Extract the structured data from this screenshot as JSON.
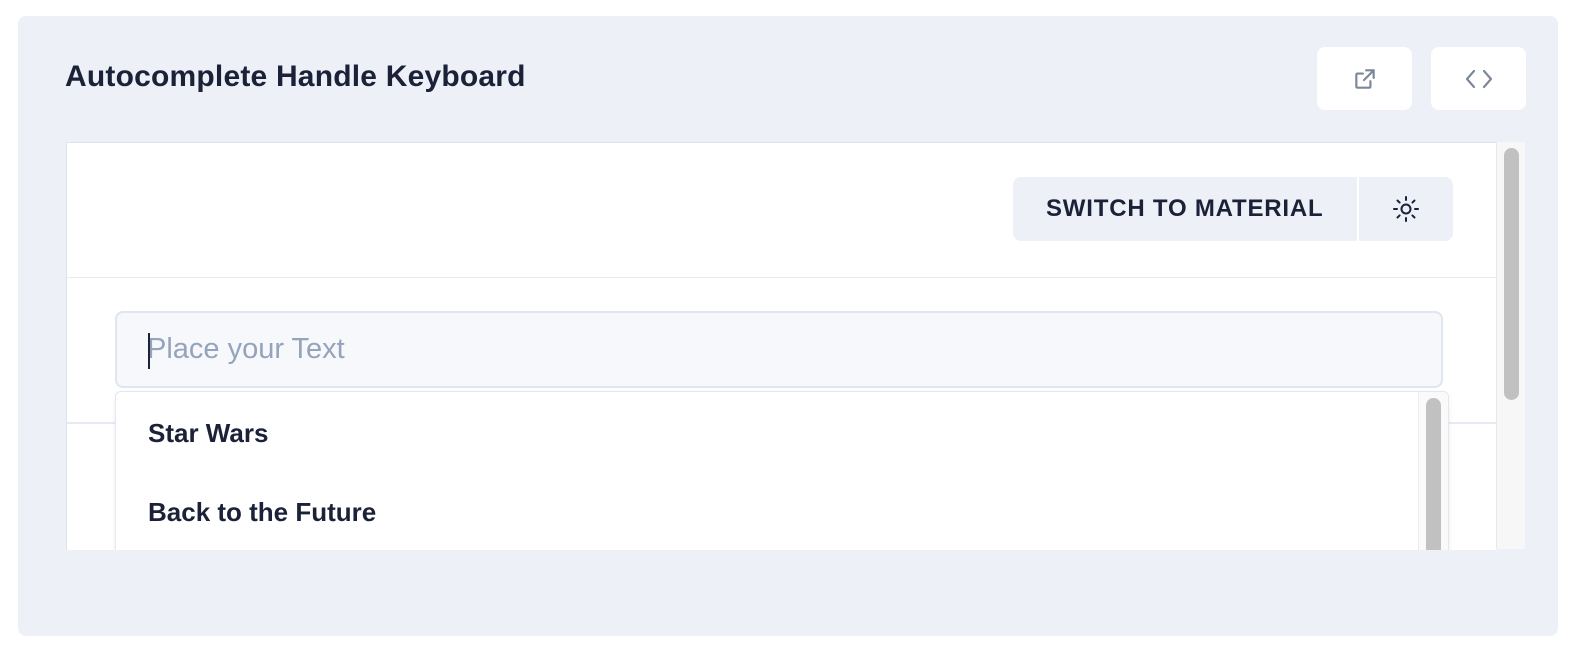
{
  "panel": {
    "title": "Autocomplete Handle Keyboard"
  },
  "toolbar": {
    "switch_label": "SWITCH TO MATERIAL"
  },
  "search": {
    "placeholder": "Place your Text",
    "value": ""
  },
  "dropdown": {
    "options": [
      {
        "label": "Star Wars"
      },
      {
        "label": "Back to the Future"
      }
    ]
  },
  "icons": {
    "open_in_new": "external-link-icon",
    "view_code": "code-brackets-icon",
    "theme": "sun-icon"
  },
  "colors": {
    "panel_bg": "#edf0f7",
    "text_primary": "#1b2238",
    "placeholder": "#95a3bb",
    "icon_muted": "#7d879a"
  }
}
